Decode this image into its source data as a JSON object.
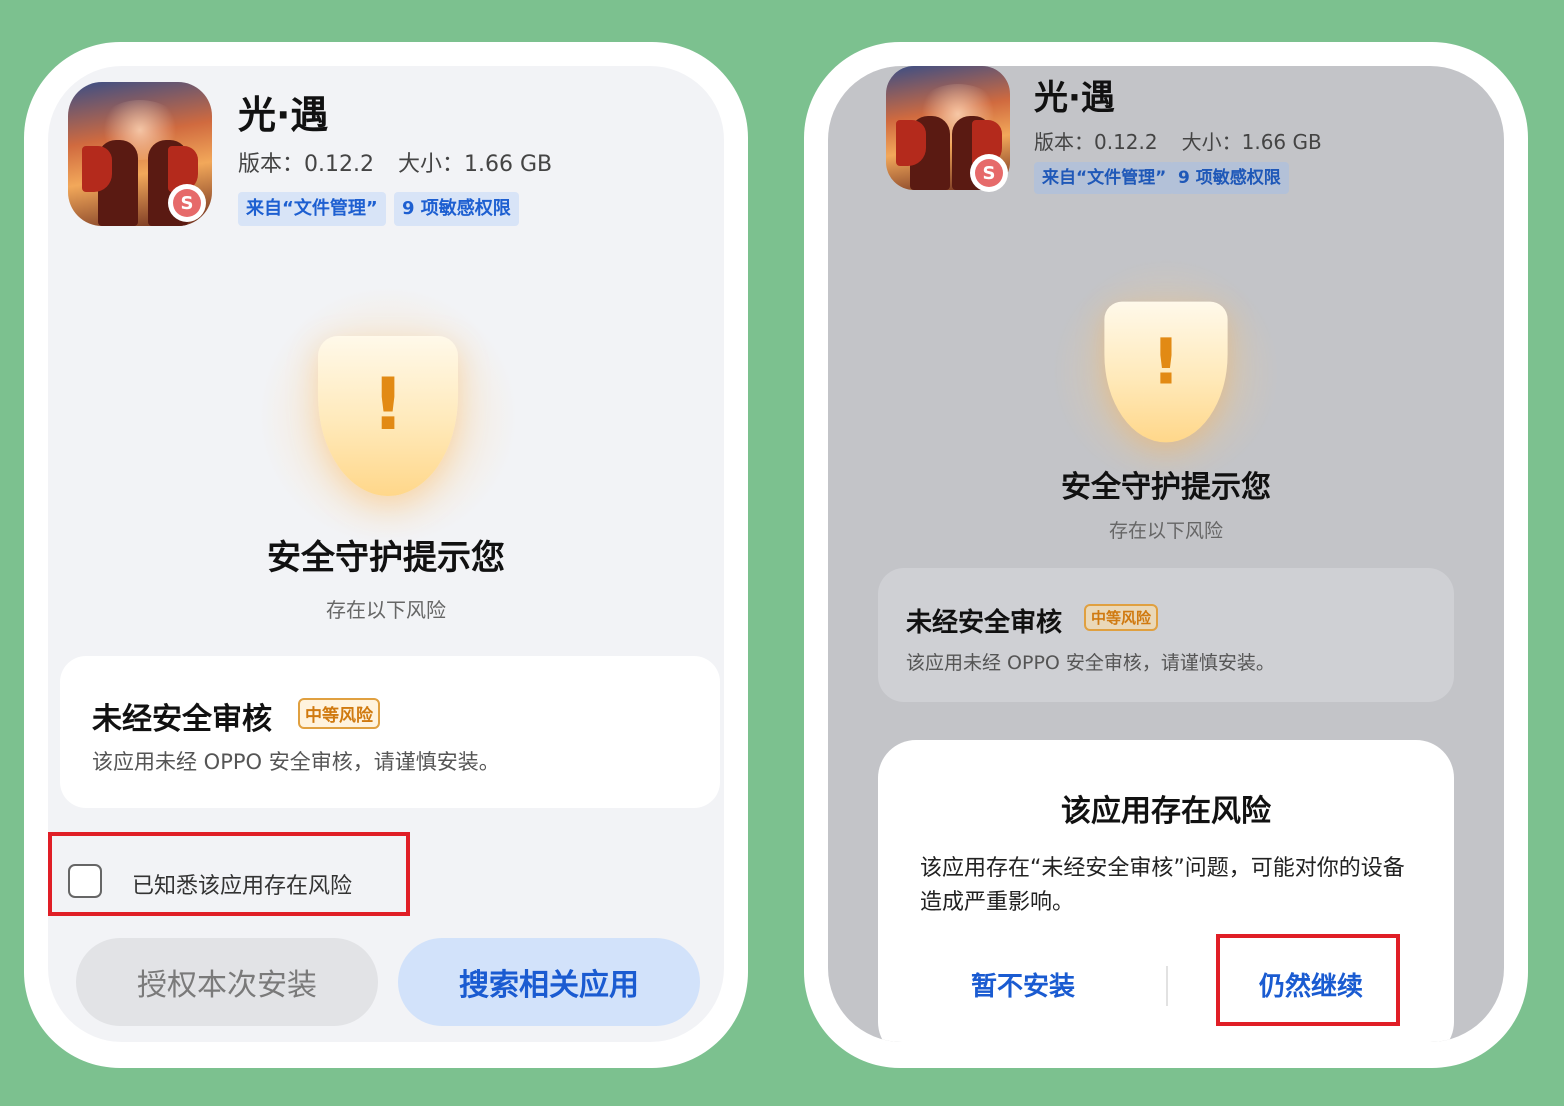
{
  "app": {
    "name": "光·遇",
    "version_label": "版本：0.12.2",
    "size_label": "大小：1.66 GB",
    "tag_source": "来自“文件管理”",
    "tag_permissions": "9 项敏感权限",
    "badge_letter": "S"
  },
  "warning": {
    "title": "安全守护提示您",
    "subtitle": "存在以下风险",
    "icon": "shield-exclamation-icon",
    "mark": "!"
  },
  "risk": {
    "title": "未经安全审核",
    "level": "中等风险",
    "description": "该应用未经 OPPO 安全审核，请谨慎安装。"
  },
  "left_screen": {
    "ack_label": "已知悉该应用存在风险",
    "authorize_button": "授权本次安装",
    "search_button": "搜索相关应用"
  },
  "dialog": {
    "title": "该应用存在风险",
    "body": "该应用存在“未经安全审核”问题，可能对你的设备造成严重影响。",
    "cancel_button": "暂不安装",
    "continue_button": "仍然继续"
  },
  "colors": {
    "background": "#7cc18f",
    "accent_blue": "#1a5bd1",
    "highlight_red": "#e01e26",
    "risk_orange": "#d07a10"
  }
}
